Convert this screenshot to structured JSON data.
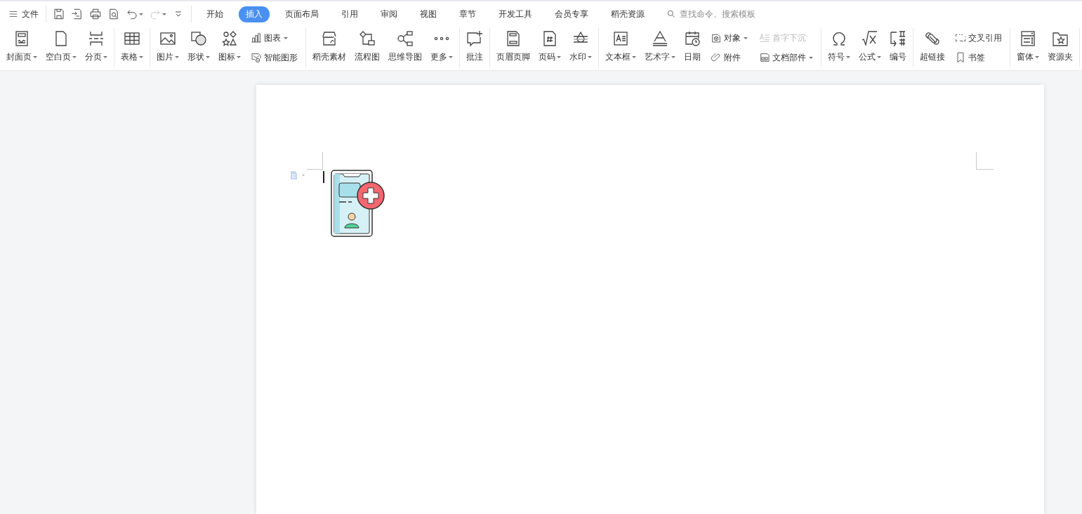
{
  "menu": {
    "label": "文件"
  },
  "quick_access": [
    {
      "kind": "save",
      "disabled": false
    },
    {
      "kind": "save-as",
      "disabled": false
    },
    {
      "kind": "print",
      "disabled": false
    },
    {
      "kind": "preview",
      "disabled": false
    },
    {
      "kind": "undo",
      "disabled": false
    },
    {
      "kind": "redo",
      "disabled": true
    },
    {
      "kind": "customize",
      "disabled": false
    }
  ],
  "tabs": [
    {
      "label": "开始",
      "selected": false
    },
    {
      "label": "插入",
      "selected": true
    },
    {
      "label": "页面布局",
      "selected": false
    },
    {
      "label": "引用",
      "selected": false
    },
    {
      "label": "审阅",
      "selected": false
    },
    {
      "label": "视图",
      "selected": false
    },
    {
      "label": "章节",
      "selected": false
    },
    {
      "label": "开发工具",
      "selected": false
    },
    {
      "label": "会员专享",
      "selected": false
    },
    {
      "label": "稻壳资源",
      "selected": false
    }
  ],
  "search": {
    "placeholder": "查找命令、搜索模板"
  },
  "ribbon": {
    "groups": [
      {
        "items": [
          {
            "kind": "large",
            "label": "封面页",
            "dropdown": true
          },
          {
            "kind": "large",
            "label": "空白页",
            "dropdown": true
          },
          {
            "kind": "large",
            "label": "分页",
            "dropdown": true
          }
        ]
      },
      {
        "items": [
          {
            "kind": "large",
            "label": "表格",
            "dropdown": true
          }
        ]
      },
      {
        "items": [
          {
            "kind": "large",
            "label": "图片",
            "dropdown": true
          },
          {
            "kind": "large",
            "label": "形状",
            "dropdown": true
          },
          {
            "kind": "large",
            "label": "图标",
            "dropdown": true
          },
          {
            "kind": "stack",
            "items": [
              {
                "label": "图表",
                "dropdown": true,
                "disabled": false
              },
              {
                "label": "智能图形",
                "dropdown": false,
                "disabled": false
              }
            ]
          }
        ]
      },
      {
        "items": [
          {
            "kind": "large",
            "label": "稻壳素材",
            "dropdown": false
          },
          {
            "kind": "large",
            "label": "流程图",
            "dropdown": false
          },
          {
            "kind": "large",
            "label": "思维导图",
            "dropdown": false
          },
          {
            "kind": "large",
            "label": "更多",
            "dropdown": true
          }
        ]
      },
      {
        "items": [
          {
            "kind": "large",
            "label": "批注",
            "dropdown": false
          }
        ]
      },
      {
        "items": [
          {
            "kind": "large",
            "label": "页眉页脚",
            "dropdown": false
          },
          {
            "kind": "large",
            "label": "页码",
            "dropdown": true
          },
          {
            "kind": "large",
            "label": "水印",
            "dropdown": true
          }
        ]
      },
      {
        "items": [
          {
            "kind": "large",
            "label": "文本框",
            "dropdown": true
          },
          {
            "kind": "large",
            "label": "艺术字",
            "dropdown": true
          },
          {
            "kind": "large",
            "label": "日期",
            "dropdown": false
          },
          {
            "kind": "stack",
            "items": [
              {
                "label": "对象",
                "dropdown": true,
                "disabled": false
              },
              {
                "label": "附件",
                "dropdown": false,
                "disabled": false
              }
            ]
          },
          {
            "kind": "stack",
            "items": [
              {
                "label": "首字下沉",
                "dropdown": false,
                "disabled": true
              },
              {
                "label": "文档部件",
                "dropdown": true,
                "disabled": false
              }
            ]
          }
        ]
      },
      {
        "items": [
          {
            "kind": "large",
            "label": "符号",
            "dropdown": true
          },
          {
            "kind": "large",
            "label": "公式",
            "dropdown": true
          },
          {
            "kind": "large",
            "label": "编号",
            "dropdown": false
          }
        ]
      },
      {
        "items": [
          {
            "kind": "large",
            "label": "超链接",
            "dropdown": false
          },
          {
            "kind": "stack",
            "items": [
              {
                "label": "交叉引用",
                "dropdown": false,
                "disabled": false
              },
              {
                "label": "书签",
                "dropdown": false,
                "disabled": false
              }
            ]
          }
        ]
      },
      {
        "items": [
          {
            "kind": "large",
            "label": "窗体",
            "dropdown": true
          },
          {
            "kind": "large",
            "label": "资源夹",
            "dropdown": false
          }
        ]
      }
    ]
  }
}
